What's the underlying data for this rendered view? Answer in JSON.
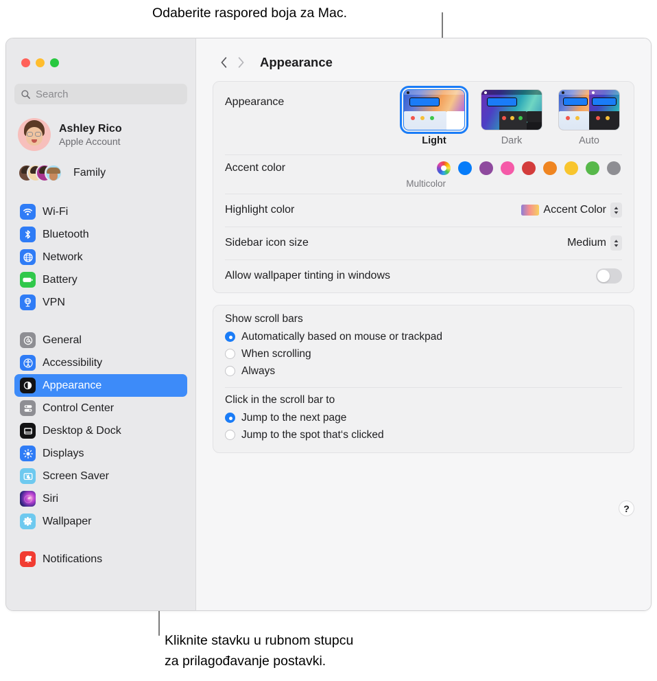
{
  "callouts": {
    "top": "Odaberite raspored boja za Mac.",
    "bottom": "Kliknite stavku u rubnom stupcu\nza prilagođavanje postavki."
  },
  "window": {
    "traffic_lights": [
      "close",
      "minimize",
      "zoom"
    ],
    "colors": {
      "close": "#ff6159",
      "minimize": "#ffbd2e",
      "zoom": "#28c840"
    }
  },
  "sidebar": {
    "search": {
      "placeholder": "Search"
    },
    "account": {
      "name": "Ashley Rico",
      "subtitle": "Apple Account"
    },
    "family": {
      "label": "Family"
    },
    "group1": [
      {
        "label": "Wi-Fi",
        "icon": "wifi-icon"
      },
      {
        "label": "Bluetooth",
        "icon": "bluetooth-icon"
      },
      {
        "label": "Network",
        "icon": "network-icon"
      },
      {
        "label": "Battery",
        "icon": "battery-icon"
      },
      {
        "label": "VPN",
        "icon": "vpn-icon"
      }
    ],
    "group2": [
      {
        "label": "General",
        "icon": "gear-icon"
      },
      {
        "label": "Accessibility",
        "icon": "accessibility-icon"
      },
      {
        "label": "Appearance",
        "icon": "appearance-icon",
        "selected": true
      },
      {
        "label": "Control Center",
        "icon": "control-center-icon"
      },
      {
        "label": "Desktop & Dock",
        "icon": "desktop-dock-icon"
      },
      {
        "label": "Displays",
        "icon": "displays-icon"
      },
      {
        "label": "Screen Saver",
        "icon": "screen-saver-icon"
      },
      {
        "label": "Siri",
        "icon": "siri-icon"
      },
      {
        "label": "Wallpaper",
        "icon": "wallpaper-icon"
      }
    ],
    "group3": [
      {
        "label": "Notifications",
        "icon": "notifications-icon"
      }
    ]
  },
  "detail": {
    "title": "Appearance",
    "nav": {
      "back": "chevron-left-icon",
      "forward": "chevron-right-icon"
    },
    "appearance": {
      "label": "Appearance",
      "options": [
        {
          "label": "Light",
          "selected": true
        },
        {
          "label": "Dark",
          "selected": false
        },
        {
          "label": "Auto",
          "selected": false
        }
      ]
    },
    "accent_color": {
      "label": "Accent color",
      "caption": "Multicolor",
      "selected_index": 0,
      "swatches": [
        {
          "name": "multicolor",
          "color": "multi"
        },
        {
          "name": "blue",
          "color": "#067cf9"
        },
        {
          "name": "purple",
          "color": "#8e4a9e"
        },
        {
          "name": "pink",
          "color": "#f55aa8"
        },
        {
          "name": "red",
          "color": "#d33c3c"
        },
        {
          "name": "orange",
          "color": "#ef8521"
        },
        {
          "name": "yellow",
          "color": "#f8c52e"
        },
        {
          "name": "green",
          "color": "#57b84a"
        },
        {
          "name": "graphite",
          "color": "#8e8e93"
        }
      ]
    },
    "highlight_color": {
      "label": "Highlight color",
      "value": "Accent Color"
    },
    "sidebar_icon_size": {
      "label": "Sidebar icon size",
      "value": "Medium"
    },
    "wallpaper_tinting": {
      "label": "Allow wallpaper tinting in windows",
      "enabled": false
    },
    "show_scroll_bars": {
      "title": "Show scroll bars",
      "options": [
        {
          "label": "Automatically based on mouse or trackpad",
          "selected": true
        },
        {
          "label": "When scrolling",
          "selected": false
        },
        {
          "label": "Always",
          "selected": false
        }
      ]
    },
    "click_scroll_bar": {
      "title": "Click in the scroll bar to",
      "options": [
        {
          "label": "Jump to the next page",
          "selected": true
        },
        {
          "label": "Jump to the spot that‘s clicked",
          "selected": false
        }
      ]
    },
    "help": {
      "label": "?"
    }
  }
}
